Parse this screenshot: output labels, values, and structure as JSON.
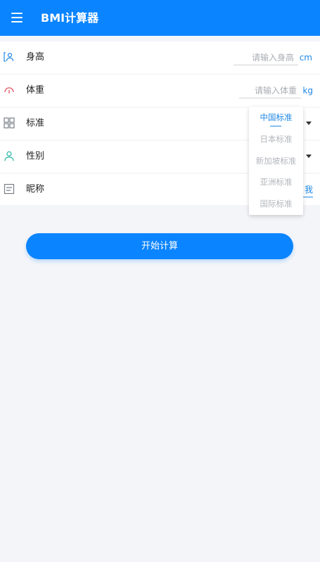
{
  "appbar": {
    "title": "BMI计算器",
    "menu_icon": "hamburger-menu-icon",
    "color": "#0a84ff"
  },
  "form": {
    "height": {
      "label": "身高",
      "placeholder": "请输入身高",
      "unit": "cm",
      "icon": "person-frame-icon"
    },
    "weight": {
      "label": "体重",
      "placeholder": "请输入体重",
      "unit": "kg",
      "icon": "gauge-icon"
    },
    "standard": {
      "label": "标准",
      "icon": "grid-icon"
    },
    "gender": {
      "label": "性别",
      "icon": "person-icon"
    },
    "nickname": {
      "label": "昵称",
      "partial_value": "我",
      "icon": "note-icon"
    }
  },
  "dropdown": {
    "options": [
      "中国标准",
      "日本标准",
      "新加坡标准",
      "亚洲标准",
      "国际标准"
    ],
    "selected": "中国标准"
  },
  "actions": {
    "start_label": "开始计算"
  },
  "colors": {
    "accent": "#1e88e5",
    "primary": "#0a84ff",
    "background": "#f4f5f9"
  }
}
